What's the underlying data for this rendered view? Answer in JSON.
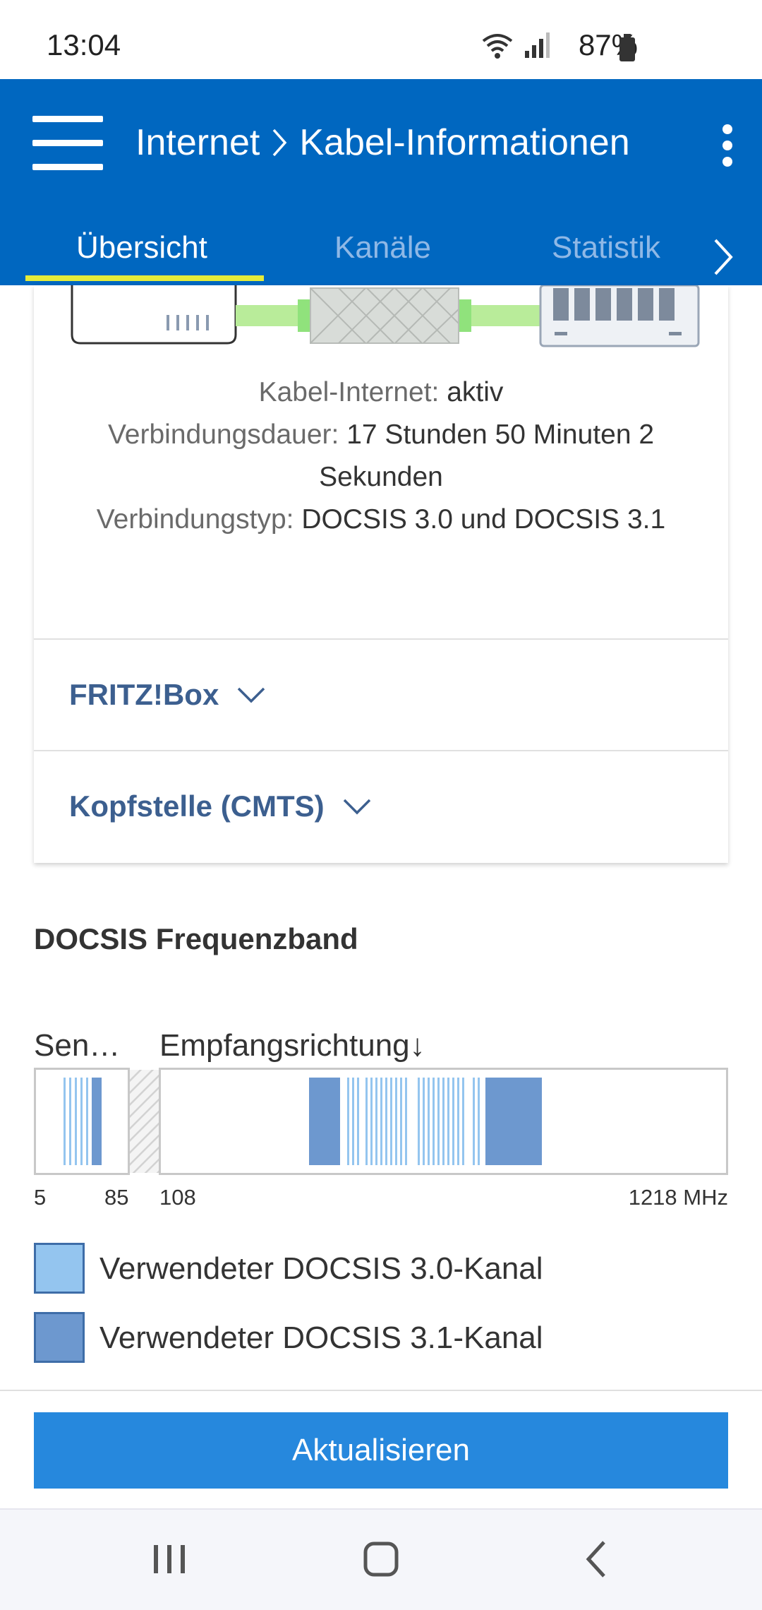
{
  "status": {
    "time": "13:04",
    "battery": "87%"
  },
  "appbar": {
    "title_part1": "Internet",
    "title_part2": "Kabel-Informationen",
    "color": "#0067c0"
  },
  "tabs": [
    {
      "label": "Übersicht",
      "active": true
    },
    {
      "label": "Kanäle",
      "active": false
    },
    {
      "label": "Statistik",
      "active": false
    }
  ],
  "connection": {
    "cable_label": "Kabel-Internet:",
    "cable_value": "aktiv",
    "duration_label": "Verbindungsdauer:",
    "duration_value": "17 Stunden 50 Minuten 2 Sekunden",
    "type_label": "Verbindungstyp:",
    "type_value": "DOCSIS 3.0 und DOCSIS 3.1"
  },
  "accordions": [
    {
      "label": "FRITZ!Box"
    },
    {
      "label": "Kopfstelle (CMTS)"
    }
  ],
  "docsis": {
    "section_title": "DOCSIS Frequenzband",
    "upstream_label": "Sen…",
    "downstream_label": "Empfangsrichtung↓",
    "scale": {
      "min": "5",
      "up_max": "85",
      "down_min": "108",
      "max": "1218 MHz"
    },
    "legend": [
      {
        "label": "Verwendeter DOCSIS 3.0-Kanal",
        "color": "#94c5ef"
      },
      {
        "label": "Verwendeter DOCSIS 3.1-Kanal",
        "color": "#6d98cf"
      }
    ]
  },
  "actions": {
    "update_label": "Aktualisieren",
    "update_color": "#2688dd"
  },
  "nav": {
    "icons": [
      "recents-icon",
      "home-icon",
      "back-icon"
    ]
  }
}
